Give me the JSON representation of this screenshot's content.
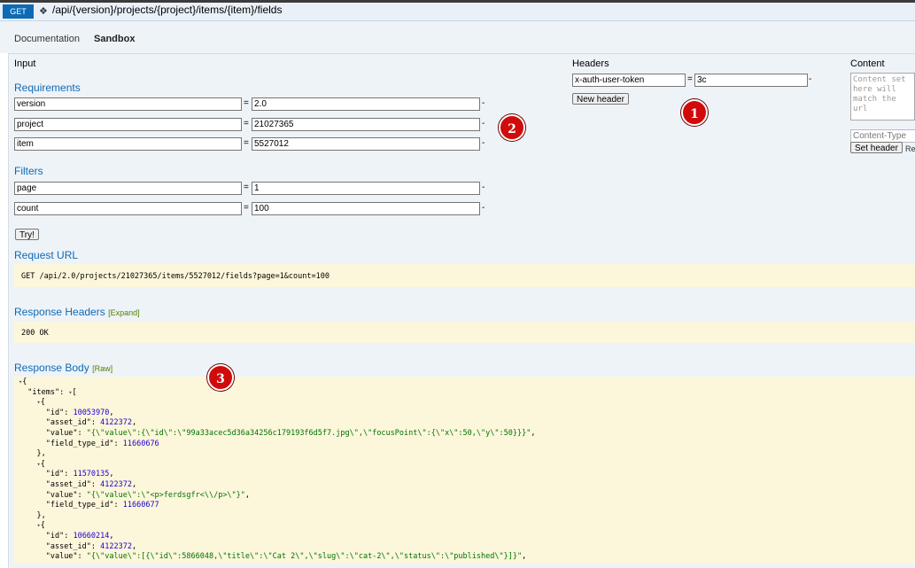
{
  "endpoint": {
    "method": "GET",
    "path": "/api/{version}/projects/{project}/items/{item}/fields"
  },
  "tabs": [
    "Documentation",
    "Sandbox"
  ],
  "input": {
    "title": "Input",
    "requirements_title": "Requirements",
    "requirements": [
      {
        "name": "version",
        "value": "2.0"
      },
      {
        "name": "project",
        "value": "21027365"
      },
      {
        "name": "item",
        "value": "5527012"
      }
    ],
    "filters_title": "Filters",
    "filters": [
      {
        "name": "page",
        "value": "1"
      },
      {
        "name": "count",
        "value": "100"
      }
    ],
    "equals": "=",
    "dash": "-",
    "try_button": "Try!"
  },
  "headers": {
    "title": "Headers",
    "name": "x-auth-user-token",
    "value": "3c",
    "new_header_button": "New header"
  },
  "content": {
    "title": "Content",
    "textarea_placeholder": "Content set here will match the url",
    "content_type_label": "Content-Type",
    "set_header_button": "Set header",
    "trailing": "Re"
  },
  "request_url": {
    "title": "Request URL",
    "value": "GET /api/2.0/projects/21027365/items/5527012/fields?page=1&count=100"
  },
  "response_headers": {
    "title": "Response Headers",
    "expand": "[Expand]",
    "value": "200 OK"
  },
  "response_body": {
    "title": "Response Body",
    "raw": "[Raw]",
    "lines": [
      "▾{",
      "  \"items\": ▾[",
      "    ▾{",
      "      \"id\": 10053970,",
      "      \"asset_id\": 4122372,",
      "      \"value\": \"{\\\"value\\\":{\\\"id\\\":\\\"99a33acec5d36a34256c179193f6d5f7.jpg\\\",\\\"focusPoint\\\":{\\\"x\\\":50,\\\"y\\\":50}}}\",",
      "      \"field_type_id\": 11660676",
      "    },",
      "    ▾{",
      "      \"id\": 11570135,",
      "      \"asset_id\": 4122372,",
      "      \"value\": \"{\\\"value\\\":\\\"<p>ferdsgfr<\\\\/p>\\\"}\",",
      "      \"field_type_id\": 11660677",
      "    },",
      "    ▾{",
      "      \"id\": 10660214,",
      "      \"asset_id\": 4122372,",
      "      \"value\": \"{\\\"value\\\":[{\\\"id\\\":5866048,\\\"title\\\":\\\"Cat 2\\\",\\\"slug\\\":\\\"cat-2\\\",\\\"status\\\":\\\"published\\\"}]}\","
    ]
  },
  "callouts": [
    "1",
    "2",
    "3"
  ]
}
